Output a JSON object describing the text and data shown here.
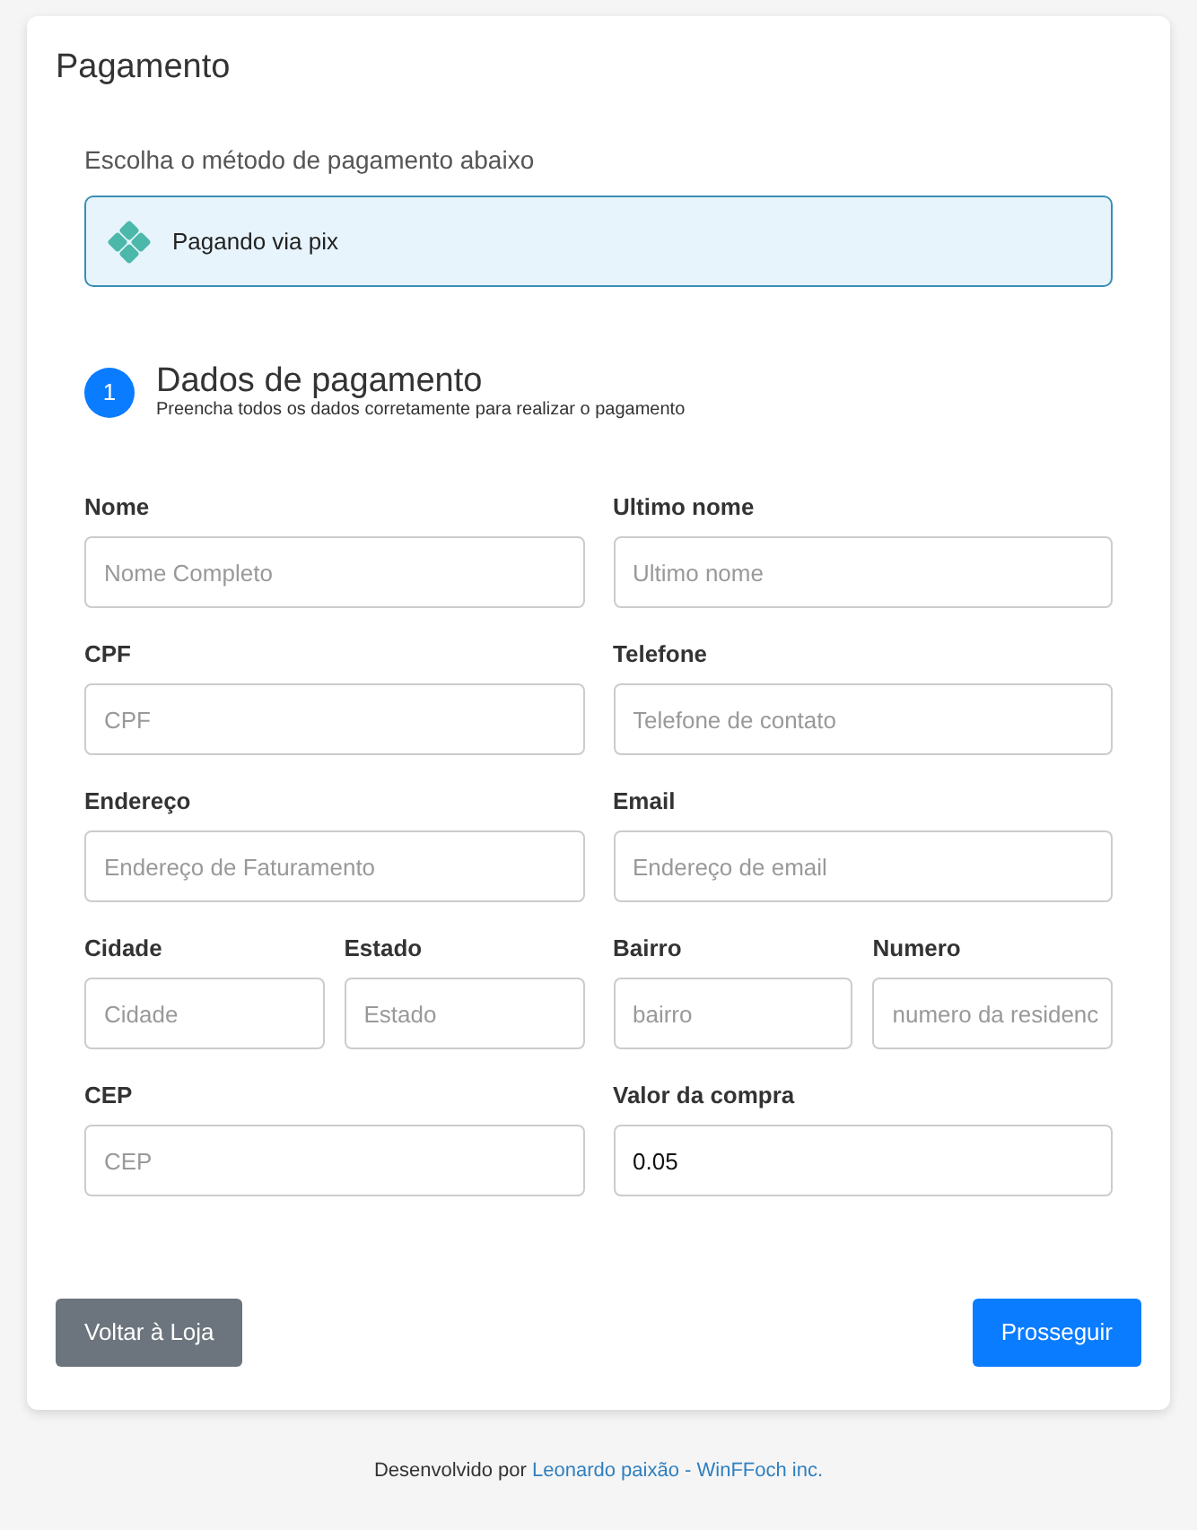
{
  "card": {
    "title": "Pagamento"
  },
  "payment_method": {
    "prompt": "Escolha o método de pagamento abaixo",
    "option": {
      "label": "Pagando via pix",
      "selected": true
    }
  },
  "step": {
    "number": "1",
    "title": "Dados de pagamento",
    "subtitle": "Preencha todos os dados corretamente para realizar o pagamento"
  },
  "form": {
    "rows": [
      [
        [
          {
            "label": "Nome",
            "placeholder": "Nome Completo"
          }
        ],
        [
          {
            "label": "Ultimo nome",
            "placeholder": "Ultimo nome"
          }
        ]
      ],
      [
        [
          {
            "label": "CPF",
            "placeholder": "CPF"
          }
        ],
        [
          {
            "label": "Telefone",
            "placeholder": "Telefone de contato"
          }
        ]
      ],
      [
        [
          {
            "label": "Endereço",
            "placeholder": "Endereço de Faturamento"
          }
        ],
        [
          {
            "label": "Email",
            "placeholder": "Endereço de email"
          }
        ]
      ],
      [
        [
          {
            "label": "Cidade",
            "placeholder": "Cidade"
          },
          {
            "label": "Estado",
            "placeholder": "Estado"
          }
        ],
        [
          {
            "label": "Bairro",
            "placeholder": "bairro"
          },
          {
            "label": "Numero",
            "placeholder": "numero da residenc"
          }
        ]
      ],
      [
        [
          {
            "label": "CEP",
            "placeholder": "CEP"
          }
        ],
        [
          {
            "label": "Valor da compra",
            "value": "0.05"
          }
        ]
      ]
    ]
  },
  "buttons": [
    {
      "label": "Voltar à Loja",
      "kind": "secondary"
    },
    {
      "label": "Prosseguir",
      "kind": "primary"
    }
  ],
  "footer": {
    "text": "Desenvolvido por",
    "link": "Leonardo paixão - WinFFoch inc."
  }
}
